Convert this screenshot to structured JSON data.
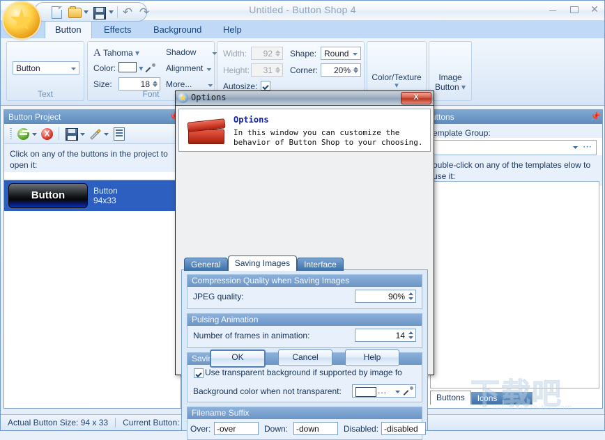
{
  "window": {
    "title": "Untitled - Button Shop 4",
    "minimize": "–",
    "maximize": "□",
    "close": "✕"
  },
  "quick_access": {
    "new": "new-document",
    "open": "open-folder",
    "save": "save-floppy",
    "undo": "↶",
    "redo": "↷"
  },
  "ribbon": {
    "tabs": [
      {
        "label": "Button",
        "active": true
      },
      {
        "label": "Effects",
        "active": false
      },
      {
        "label": "Background",
        "active": false
      },
      {
        "label": "Help",
        "active": false
      }
    ],
    "groups": {
      "text": {
        "label": "Text",
        "value": "Button"
      },
      "font": {
        "label": "Font",
        "font_name": "Tahoma",
        "color_label": "Color:",
        "color_value": "#ffffff",
        "size_label": "Size:",
        "size_value": "18",
        "shadow": "Shadow",
        "alignment": "Alignment",
        "more": "More..."
      },
      "size": {
        "width_label": "Width:",
        "width_value": "92",
        "height_label": "Height:",
        "height_value": "31",
        "autosize_label": "Autosize:",
        "autosize_checked": true,
        "shape_label": "Shape:",
        "shape_value": "Round",
        "corner_label": "Corner:",
        "corner_value": "20%"
      },
      "color_texture": {
        "label": "Color/Texture"
      },
      "image_button": {
        "label": "Image\nButton"
      }
    }
  },
  "left_panel": {
    "title": "Button Project",
    "pin": "▮",
    "toolbar": [
      {
        "name": "add-button",
        "icon": "green-plus-icon"
      },
      {
        "name": "delete-button",
        "icon": "red-x-icon"
      },
      {
        "name": "save-project",
        "icon": "floppy-icon"
      },
      {
        "name": "wizard",
        "icon": "magic-wand-icon"
      },
      {
        "name": "properties",
        "icon": "list-icon"
      }
    ],
    "hint": "Click on any of the buttons in the project to open it:",
    "items": [
      {
        "preview_text": "Button",
        "name": "Button",
        "size": "94x33"
      }
    ]
  },
  "right_panel": {
    "title": "uttons",
    "pin": "▮",
    "template_group_label": "emplate Group:",
    "template_group_value": "",
    "hint": "ouble-click on any of the templates elow to use it:",
    "tabs": [
      {
        "label": "Buttons",
        "active": true
      },
      {
        "label": "Icons",
        "active": false
      }
    ]
  },
  "dialog": {
    "titlebar": "Options",
    "close": "X",
    "header_title": "Options",
    "header_text": "In this window you can customize the behavior of Button Shop to your choosing.",
    "tabs": [
      {
        "label": "General",
        "active": false
      },
      {
        "label": "Saving Images",
        "active": true
      },
      {
        "label": "Interface",
        "active": false
      }
    ],
    "groups": {
      "compression": {
        "title": "Compression Quality when Saving Images",
        "jpeg_label": "JPEG quality:",
        "jpeg_value": "90%"
      },
      "pulsing": {
        "title": "Pulsing Animation",
        "frames_label": "Number of frames in animation:",
        "frames_value": "14"
      },
      "saving": {
        "title": "Saving Images",
        "transparent_label": "Use transparent background if supported by image fo",
        "transparent_checked": true,
        "bgcolor_label": "Background color when not transparent:",
        "bgcolor_value": "#ffffff",
        "bgcolor_dots": "..."
      },
      "suffix": {
        "title": "Filename Suffix",
        "over_label": "Over:",
        "over_value": "-over",
        "down_label": "Down:",
        "down_value": "-down",
        "disabled_label": "Disabled:",
        "disabled_value": "-disabled"
      }
    },
    "buttons": {
      "ok": "OK",
      "cancel": "Cancel",
      "help": "Help"
    }
  },
  "statusbar": {
    "actual_size": "Actual Button Size:  94 x 33",
    "current_button": "Current Button:  Button"
  },
  "watermark": {
    "cn": "下载吧",
    "url": "www.xiazaiba.com"
  }
}
